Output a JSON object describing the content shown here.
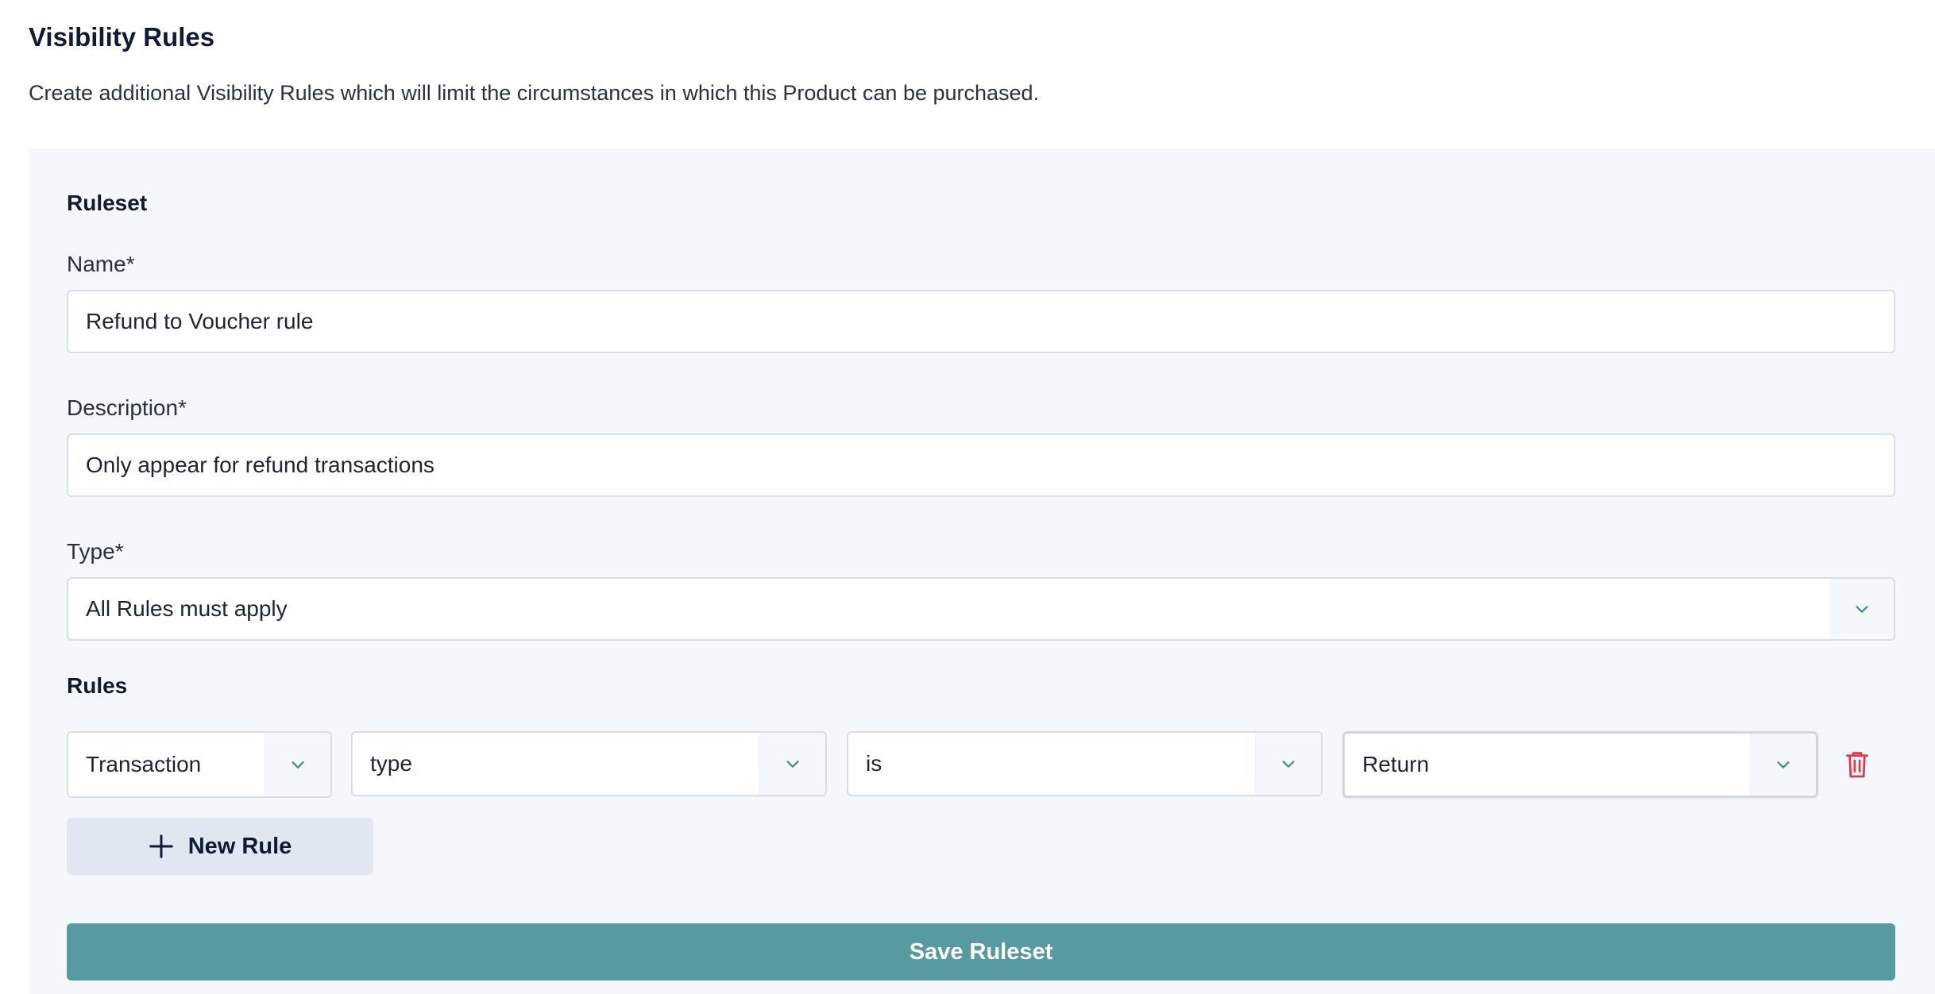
{
  "header": {
    "title": "Visibility Rules",
    "description": "Create additional Visibility Rules which will limit the circumstances in which this Product can be purchased."
  },
  "ruleset": {
    "section_title": "Ruleset",
    "name_label": "Name*",
    "name_value": "Refund to Voucher rule",
    "description_label": "Description*",
    "description_value": "Only appear for refund transactions",
    "type_label": "Type*",
    "type_value": "All Rules must apply"
  },
  "rules": {
    "section_title": "Rules",
    "items": [
      {
        "subject": "Transaction",
        "property": "type",
        "operator": "is",
        "value": "Return"
      }
    ],
    "new_rule_label": "New Rule"
  },
  "actions": {
    "save_label": "Save Ruleset"
  },
  "icons": {
    "caret": "chevron-down-icon",
    "delete": "trash-icon",
    "add": "plus-icon"
  },
  "colors": {
    "panel_bg": "#f4f7fb",
    "caret_color": "#3d8a91",
    "delete_color": "#e0384b",
    "save_bg": "#579a9f",
    "new_rule_bg": "#e1e7f1"
  }
}
